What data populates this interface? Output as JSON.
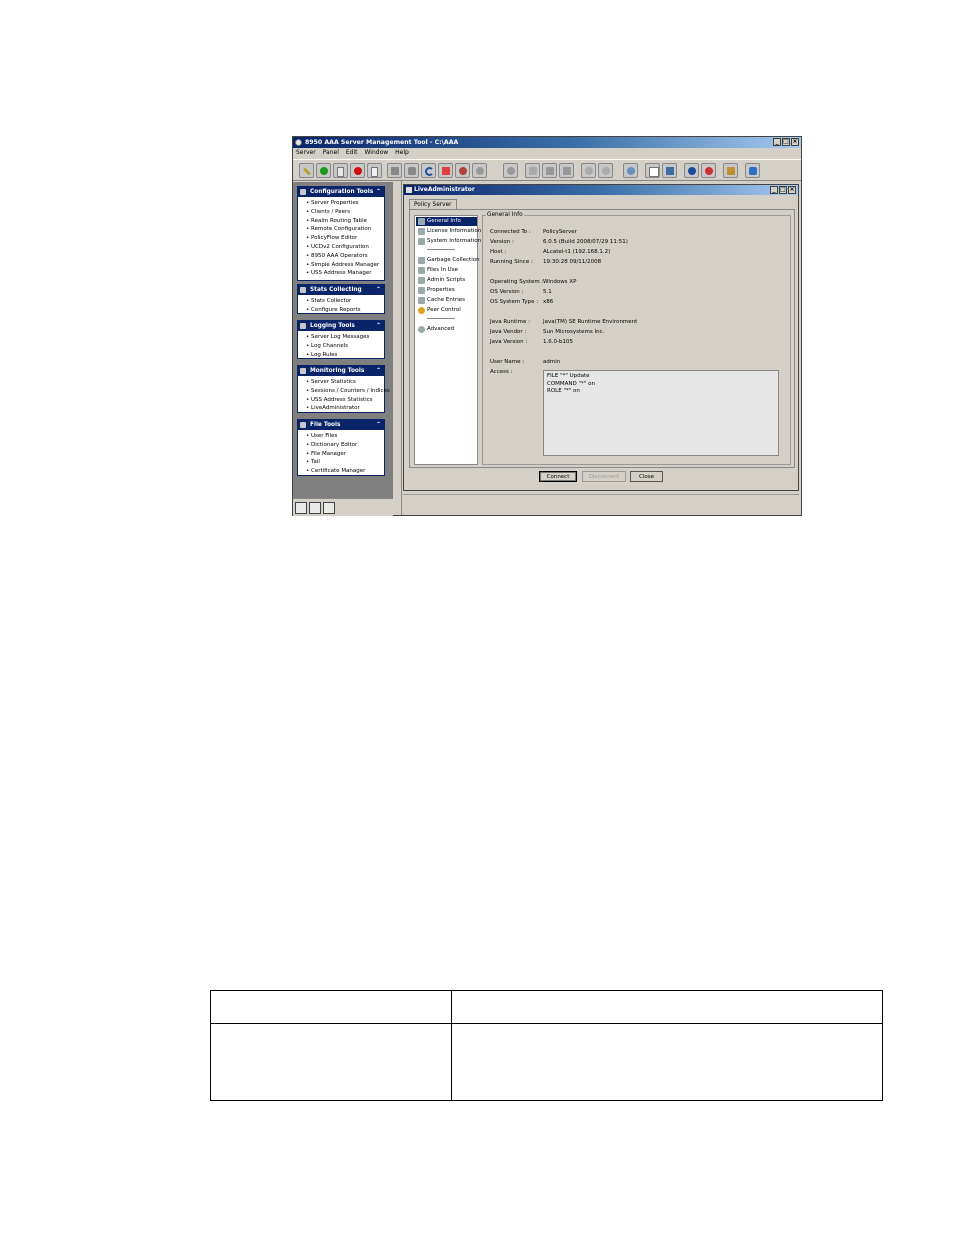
{
  "app": {
    "title": "8950 AAA Server Management Tool - C:\\AAA",
    "window_controls": [
      "_",
      "□",
      "×"
    ],
    "menu": [
      "Server",
      "Panel",
      "Edit",
      "Window",
      "Help"
    ]
  },
  "toolbar": {
    "icons": [
      "connect-icon",
      "green-status-icon",
      "server-icon",
      "red-status-icon",
      "document-icon",
      "stop-icon",
      "database-icon",
      "refresh-icon",
      "cancel-icon",
      "disconnect-icon",
      "print-icon",
      "sync-icon",
      "cut-icon",
      "copy-icon",
      "paste-icon",
      "zoom-in-icon",
      "zoom-out-icon",
      "settings-icon",
      "report-icon",
      "monitor-icon",
      "help-icon",
      "info-icon",
      "tools-icon",
      "storage-icon"
    ]
  },
  "sidebar": {
    "sections": [
      {
        "title": "Configuration Tools",
        "items": [
          "Server Properties",
          "Clients / Peers",
          "Realm Routing Table",
          "Remote Configuration",
          "PolicyFlow Editor",
          "UCDv2 Configuration",
          "8950 AAA Operators",
          "Simple Address Manager",
          "USS Address Manager"
        ]
      },
      {
        "title": "Stats Collecting",
        "items": [
          "Stats Collector",
          "Configure Reports"
        ]
      },
      {
        "title": "Logging Tools",
        "items": [
          "Server Log Messages",
          "Log Channels",
          "Log Rules"
        ]
      },
      {
        "title": "Monitoring Tools",
        "items": [
          "Server Statistics",
          "Sessions / Counters / Indices",
          "USS Address Statistics",
          "LiveAdministrator"
        ]
      },
      {
        "title": "File Tools",
        "items": [
          "User Files",
          "Dictionary Editor",
          "File Manager",
          "Tail",
          "Certificate Manager"
        ]
      }
    ]
  },
  "child_window": {
    "title": "LiveAdministrator",
    "tab": "Policy Server",
    "nav": {
      "group1": [
        "General Info",
        "License Information",
        "System Information"
      ],
      "group2": [
        "Garbage Collection",
        "Files In Use",
        "Admin Scripts",
        "Properties",
        "Cache Entries",
        "Peer Control"
      ],
      "group3": [
        "Advanced"
      ]
    },
    "general_info": {
      "legend": "General Info",
      "fields": [
        {
          "label": "Connected To :",
          "value": "PolicyServer"
        },
        {
          "label": "Version :",
          "value": "6.0.5 (Build 2008/07/29 11:51)"
        },
        {
          "label": "Host :",
          "value": "ALcatel-t1 (192.168.1.2)"
        },
        {
          "label": "Running Since :",
          "value": "19:30:28 09/11/2008"
        },
        {
          "label": "Operating System :",
          "value": "Windows XP"
        },
        {
          "label": "OS Version :",
          "value": "5.1"
        },
        {
          "label": "OS System Type :",
          "value": "x86"
        },
        {
          "label": "Java Runtime :",
          "value": "Java(TM) SE Runtime Environment"
        },
        {
          "label": "Java Vendor :",
          "value": "Sun Microsystems Inc."
        },
        {
          "label": "Java Version :",
          "value": "1.6.0-b105"
        },
        {
          "label": "User Name :",
          "value": "admin"
        }
      ],
      "access_label": "Access :",
      "access_lines": [
        "FILE \"*\" Update",
        "COMMAND \"*\" on",
        "ROLE \"*\" on"
      ]
    },
    "buttons": {
      "connect": "Connect",
      "disconnect": "Disconnect",
      "close": "Close"
    }
  },
  "doc_table": {
    "rows": [
      [
        "",
        ""
      ],
      [
        "",
        ""
      ]
    ]
  }
}
